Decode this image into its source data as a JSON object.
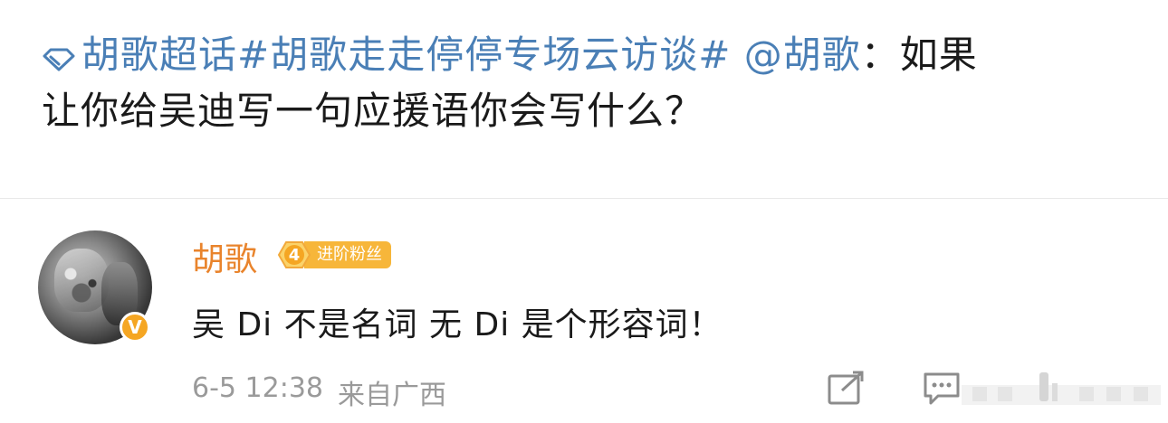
{
  "post": {
    "topic_super": "胡歌超话",
    "hashtag": "#胡歌走走停停专场云访谈#",
    "mention": "@胡歌",
    "text_part1": "：如果",
    "text_part2": "让你给吴迪写一句应援语你会写什么？"
  },
  "comment": {
    "username": "胡歌",
    "fan_level": "4",
    "fan_label": "进阶粉丝",
    "content": "吴 Di 不是名词 无 Di 是个形容词！",
    "time": "6-5 12:38",
    "source": "来自广西"
  },
  "colors": {
    "link_blue": "#4a7fb6",
    "username_orange": "#e9842c",
    "fan_badge": "#f7b63a",
    "meta_gray": "#9a9a9a"
  },
  "icons": {
    "topic": "diamond-icon",
    "verified": "verified-v-icon",
    "repost": "repost-icon",
    "comment": "comment-icon",
    "like": "like-icon"
  }
}
